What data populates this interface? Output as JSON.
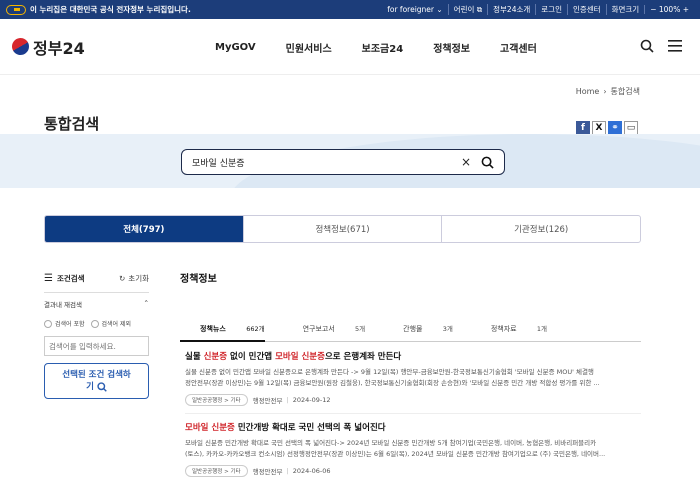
{
  "topbar": {
    "notice": "이 누리집은 대한민국 공식 전자정부 누리집입니다.",
    "links": [
      "for foreigner",
      "어린이",
      "정부24소개",
      "로그인",
      "인증센터",
      "화면크기",
      "100%"
    ]
  },
  "header": {
    "logo": "정부24",
    "nav": [
      "MyGOV",
      "민원서비스",
      "보조금24",
      "정책정보",
      "고객센터"
    ]
  },
  "breadcrumb": [
    "Home",
    "통합검색"
  ],
  "page": {
    "title": "통합검색"
  },
  "search": {
    "query": "모바일 신분증"
  },
  "tabs": [
    {
      "label": "전체(797)",
      "active": true
    },
    {
      "label": "정책정보(671)",
      "active": false
    },
    {
      "label": "기관정보(126)",
      "active": false
    }
  ],
  "filter": {
    "title": "조건검색",
    "reset": "초기화",
    "sub_title": "결과내 재검색",
    "radios": [
      "검색어 포함",
      "검색어 제외"
    ],
    "keyword_placeholder": "검색어를 입력하세요.",
    "apply": "선택된 조건 검색하기"
  },
  "content": {
    "section_title": "정책정보",
    "subtabs": [
      {
        "label": "정책뉴스",
        "count": "662개",
        "active": true
      },
      {
        "label": "연구보고서",
        "count": "5개",
        "active": false
      },
      {
        "label": "간행물",
        "count": "3개",
        "active": false
      },
      {
        "label": "정책자료",
        "count": "1개",
        "active": false
      }
    ],
    "results": [
      {
        "title_pre": "실물 ",
        "title_h1": "신분증",
        "title_mid": " 없이 민간앱 ",
        "title_h2": "모바일 신분증",
        "title_post": "으로 은행계좌 만든다",
        "desc1": "실물 신분증 없이 민간앱 모바일 신분증으로 은행계좌 만든다 -> 9월 12일(목) 행안부-금융보안원-한국정보통신기술협회 '모바일 신분증 MOU' 체결행",
        "desc2": "정안전부(장관 이상민)는 9월 12일(목) 금융보안원(원장 김철웅), 한국정보통신기술협회(회장 손승현)와 '모바일 신분증 민간 개방 적합성 평가를 위한 ...",
        "tag": "일반공공행정 > 기타",
        "agency": "행정안전부",
        "date": "2024-09-12"
      },
      {
        "title_pre": "",
        "title_h1": "모바일 신분증",
        "title_mid": " 민간개방 확대로 국민 선택의 폭 넓어진다",
        "title_h2": "",
        "title_post": "",
        "desc1": "모바일 신분증 민간개방 확대로 국민 선택의 폭 넓어진다-> 2024년 모바일 신분증 민간개방 5개 참여기업(국민은행, 네이버, 농협은행, 비바리퍼블리카",
        "desc2": "(토스), 카카오-카카오뱅크 컨소시엄) 선정행정안전부(장관 이상민)는 6월 6일(목), 2024년 모바일 신분증 민간개방 참여기업으로 (주) 국민은행, 네이버...",
        "tag": "일반공공행정 > 기타",
        "agency": "행정안전부",
        "date": "2024-06-06"
      }
    ]
  },
  "colors": {
    "primary": "#0d3b82",
    "topbar": "#1c3d7a",
    "highlight": "#d0262b",
    "band": "#e8f0f8"
  }
}
